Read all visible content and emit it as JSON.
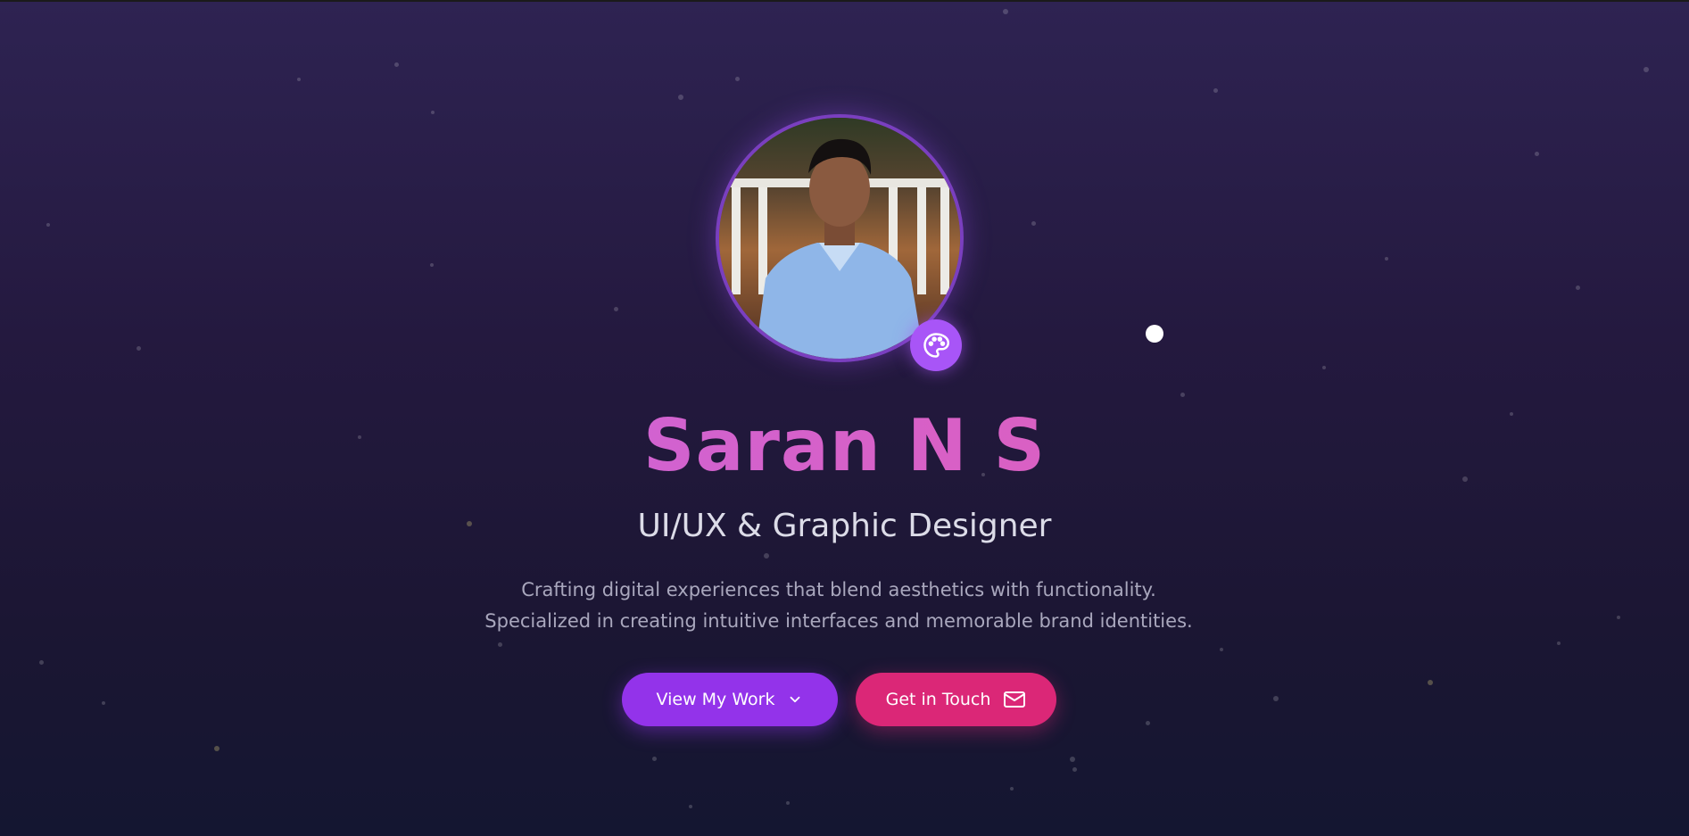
{
  "hero": {
    "name": "Saran N S",
    "role": "UI/UX & Graphic Designer",
    "description": "Crafting digital experiences that blend aesthetics with functionality. Specialized in creating intuitive interfaces and memorable brand identities.",
    "avatar_alt": "Profile photo of Saran N S",
    "badge_icon": "palette-icon"
  },
  "actions": {
    "view_work_label": "View My Work",
    "view_work_icon": "chevron-down-icon",
    "contact_label": "Get in Touch",
    "contact_icon": "mail-icon"
  },
  "colors": {
    "background_top": "#2e2352",
    "background_bottom": "#141631",
    "name_gradient_start": "#c265e6",
    "name_gradient_end": "#e45bb0",
    "primary_button": "#9333ea",
    "secondary_button": "#db2777",
    "badge": "#a855f7",
    "avatar_ring": "#7a3fbf"
  }
}
